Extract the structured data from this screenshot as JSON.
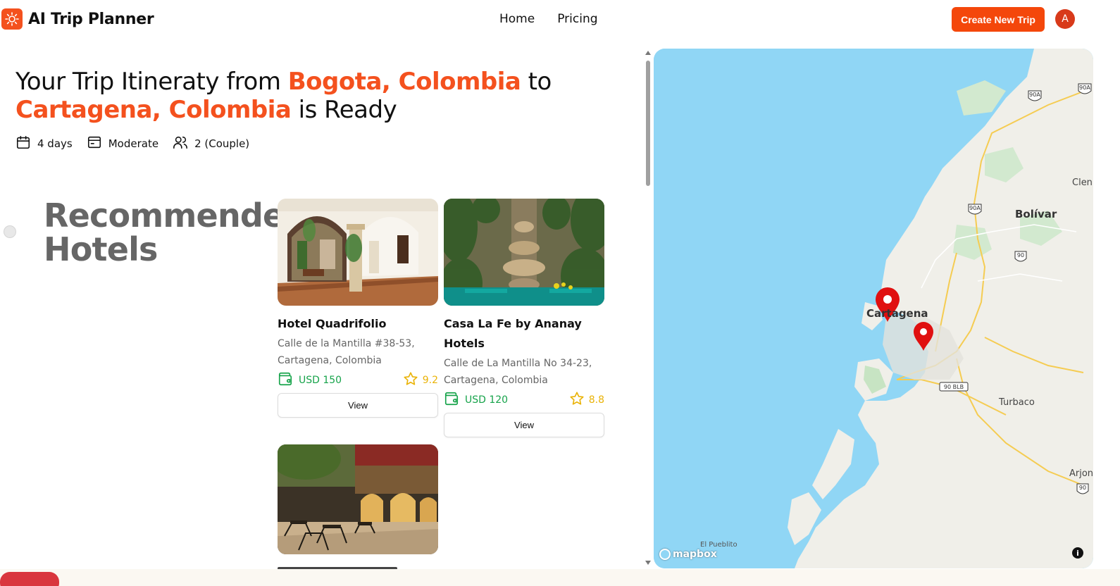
{
  "app": {
    "title": "AI Trip Planner"
  },
  "nav": {
    "items": [
      "Home",
      "Pricing"
    ],
    "create_button": "Create New Trip",
    "avatar_initial": "A"
  },
  "trip": {
    "title_prefix": "Your Trip Itineraty from ",
    "origin": "Bogota, Colombia",
    "title_middle": " to ",
    "destination": "Cartagena, Colombia",
    "title_suffix": " is Ready",
    "duration": "4 days",
    "budget": "Moderate",
    "travelers": "2 (Couple)"
  },
  "section": {
    "title": "Recommended Hotels"
  },
  "hotels": [
    {
      "name": "Hotel Quadrifolio",
      "address": "Calle de la Mantilla #38-53, Cartagena, Colombia",
      "price": "USD 150",
      "rating": "9.2",
      "view_label": "View"
    },
    {
      "name": "Casa La Fe by Ananay Hotels",
      "address": "Calle de La Mantilla No 34-23, Cartagena, Colombia",
      "price": "USD 120",
      "rating": "8.8",
      "view_label": "View"
    },
    {
      "name": "",
      "address": "",
      "price": "",
      "rating": "",
      "view_label": ""
    }
  ],
  "map": {
    "labels": {
      "bolivar": "Bolívar",
      "cartagena": "Cartagena",
      "turbaco": "Turbaco",
      "arjona": "Arjona",
      "el_pueblito": "El Pueblito",
      "clemencia": "Clen"
    },
    "route_badges": [
      "90A",
      "90A",
      "90A",
      "90",
      "90 BLB",
      "90"
    ],
    "attribution": "mapbox",
    "info": "i"
  },
  "colors": {
    "accent": "#f4511e",
    "price_green": "#16a34a",
    "rating_yellow": "#eab308",
    "water": "#90d6f5",
    "land": "#f0efe9"
  }
}
